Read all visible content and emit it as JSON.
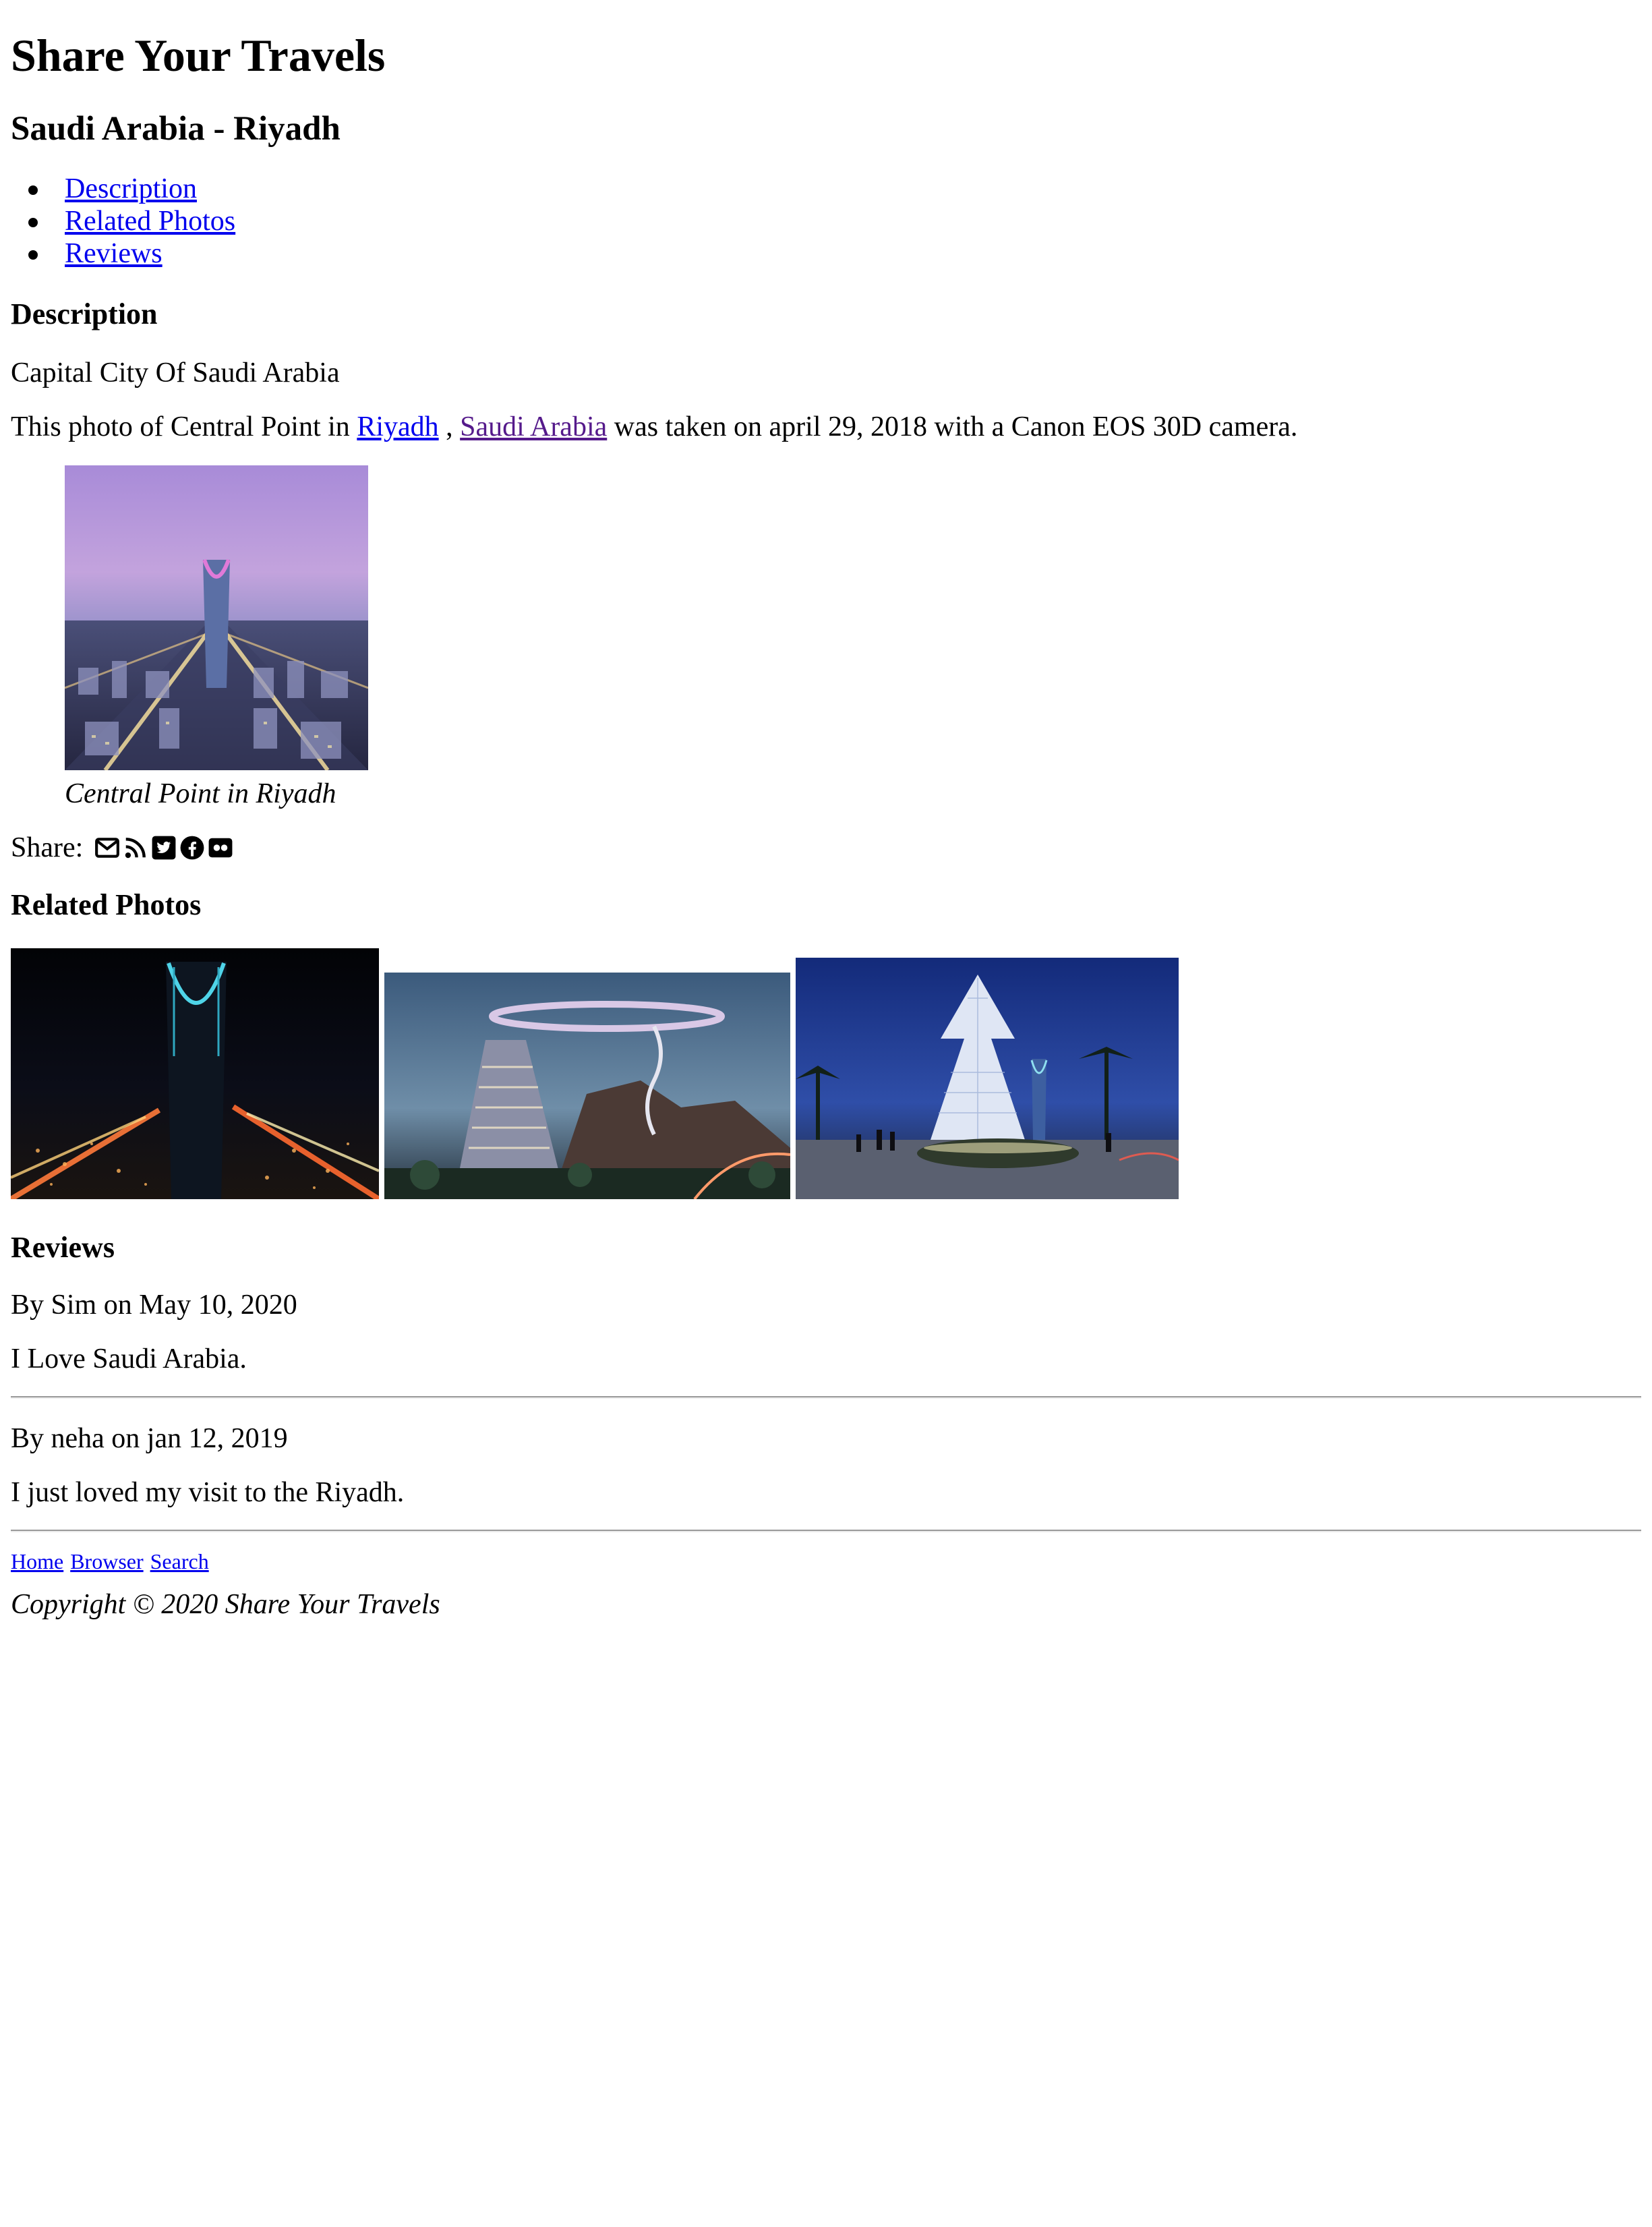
{
  "site_title": "Share Your Travels",
  "page_heading": "Saudi Arabia - Riyadh",
  "nav": {
    "items": [
      {
        "label": "Description"
      },
      {
        "label": "Related Photos"
      },
      {
        "label": "Reviews"
      }
    ]
  },
  "description": {
    "heading": "Description",
    "subtitle": "Capital City Of Saudi Arabia",
    "sentence_prefix": "This photo of Central Point in",
    "city_link": "Riyadh",
    "separator": ",",
    "country_link": "Saudi Arabia",
    "sentence_suffix": "was taken on april 29, 2018 with a Canon EOS 30D camera.",
    "figure_caption": "Central Point in Riyadh"
  },
  "share": {
    "label": "Share:",
    "icons": [
      "envelope-icon",
      "rss-icon",
      "twitter-icon",
      "facebook-icon",
      "flickr-icon"
    ]
  },
  "related": {
    "heading": "Related Photos"
  },
  "reviews": {
    "heading": "Reviews",
    "items": [
      {
        "byline": "By Sim on May 10, 2020",
        "text": "I Love Saudi Arabia."
      },
      {
        "byline": "By neha on jan 12, 2019",
        "text": "I just loved my visit to the Riyadh."
      }
    ]
  },
  "footer": {
    "links": [
      {
        "label": "Home"
      },
      {
        "label": "Browser"
      },
      {
        "label": "Search"
      }
    ],
    "copyright": "Copyright © 2020 Share Your Travels"
  },
  "colors": {
    "link": "#0000ee",
    "visited_link": "#551a8b",
    "rule": "#9a9a9a"
  }
}
